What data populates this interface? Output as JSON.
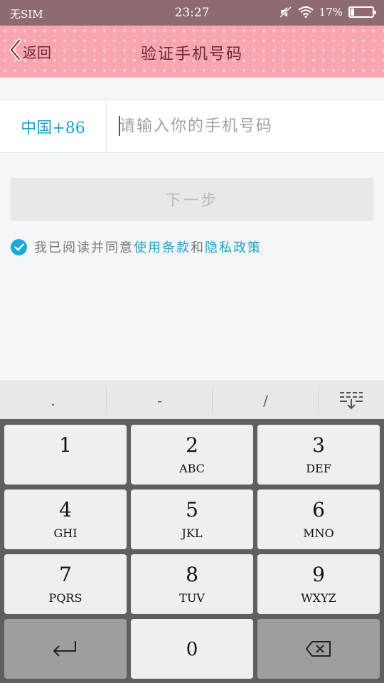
{
  "status_bar": {
    "carrier": "无SIM",
    "time": "23:27",
    "battery_percent": "17%",
    "battery_level": 0.17
  },
  "header": {
    "back_label": "返回",
    "title": "验证手机号码"
  },
  "phone": {
    "country_code": "中国+86",
    "placeholder": "请输入你的手机号码",
    "value": ""
  },
  "next_button": {
    "label": "下一步",
    "enabled": false
  },
  "agreement": {
    "prefix": "我已阅读并同意",
    "terms_link": "使用条款",
    "conjunction": "和",
    "privacy_link": "隐私政策",
    "checked": true
  },
  "keyboard": {
    "symbols": [
      ".",
      "-",
      "/"
    ],
    "keys": [
      {
        "num": "1",
        "letters": ""
      },
      {
        "num": "2",
        "letters": "ABC"
      },
      {
        "num": "3",
        "letters": "DEF"
      },
      {
        "num": "4",
        "letters": "GHI"
      },
      {
        "num": "5",
        "letters": "JKL"
      },
      {
        "num": "6",
        "letters": "MNO"
      },
      {
        "num": "7",
        "letters": "PQRS"
      },
      {
        "num": "8",
        "letters": "TUV"
      },
      {
        "num": "9",
        "letters": "WXYZ"
      }
    ],
    "zero": "0"
  },
  "colors": {
    "header_bg": "#f8a5b1",
    "header_text": "#6b2a35",
    "accent": "#1aa3c8",
    "check": "#1ba8db"
  }
}
